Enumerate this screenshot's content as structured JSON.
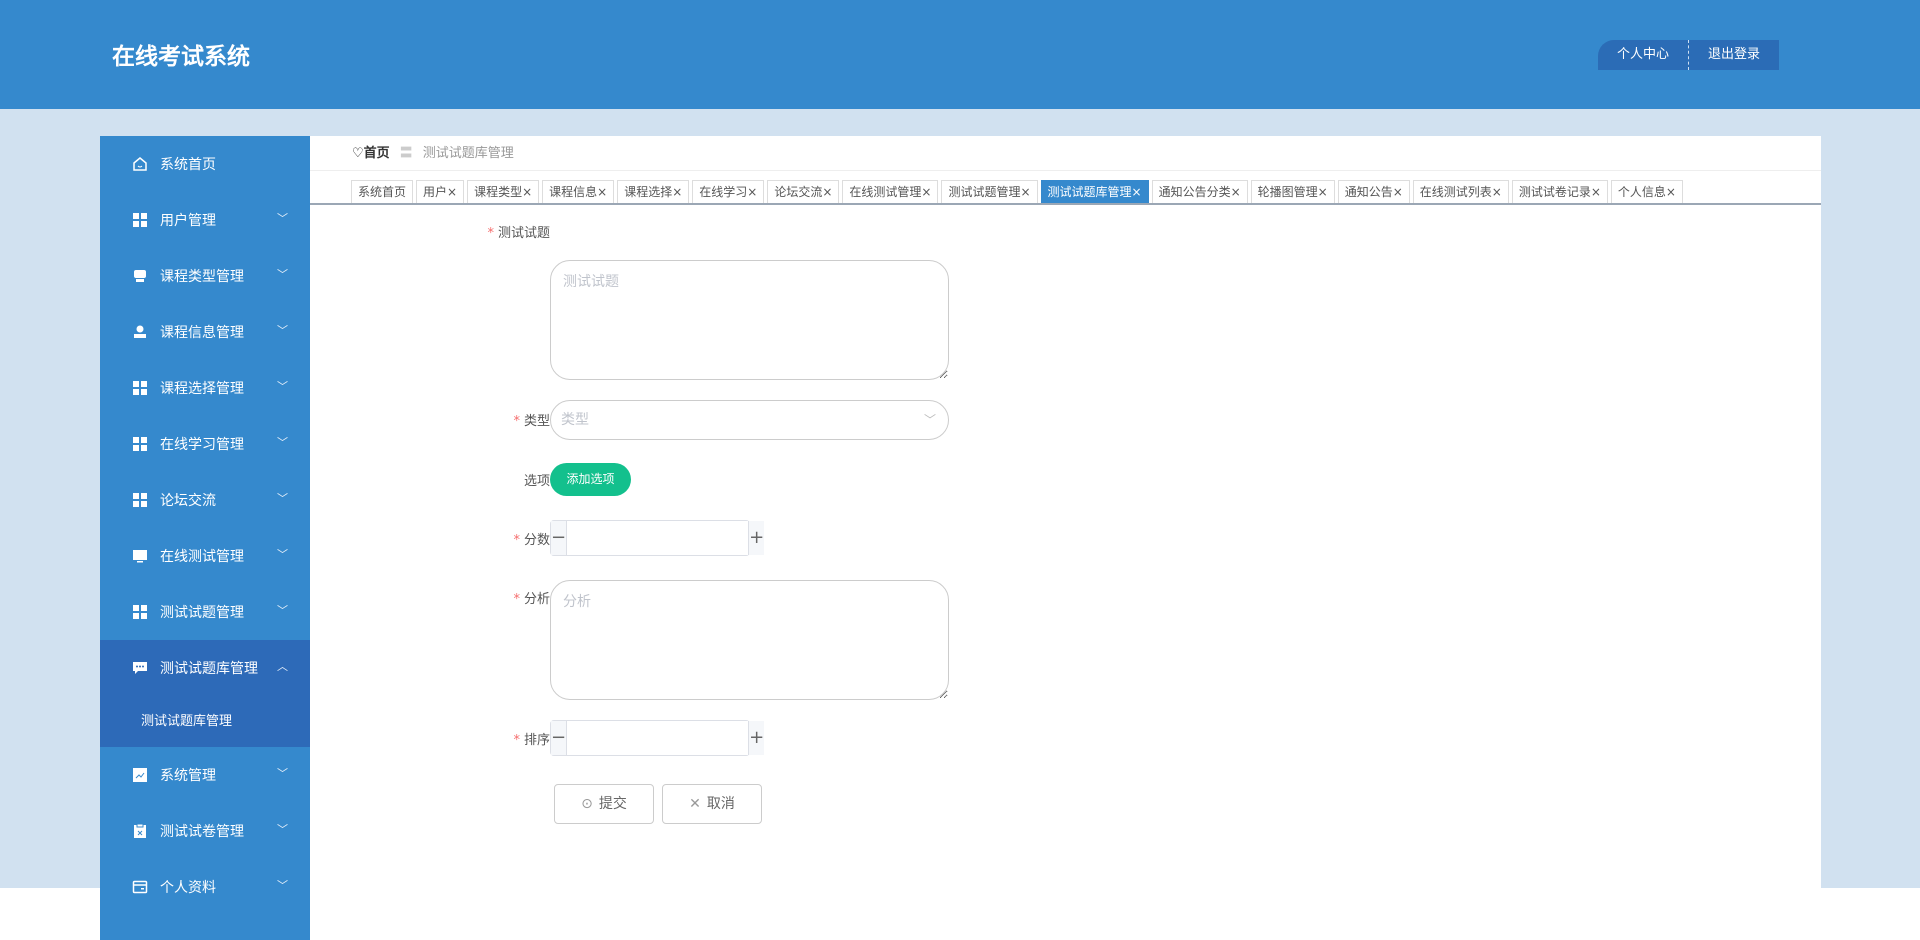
{
  "header": {
    "title": "在线考试系统",
    "personal_center": "个人中心",
    "logout": "退出登录"
  },
  "sidebar": {
    "items": [
      {
        "label": "系统首页",
        "icon": "home-icon",
        "chevron": ""
      },
      {
        "label": "用户管理",
        "icon": "grid-icon",
        "chevron": "﹀"
      },
      {
        "label": "课程类型管理",
        "icon": "tray-icon",
        "chevron": "﹀"
      },
      {
        "label": "课程信息管理",
        "icon": "stamp-icon",
        "chevron": "﹀"
      },
      {
        "label": "课程选择管理",
        "icon": "grid-icon",
        "chevron": "﹀"
      },
      {
        "label": "在线学习管理",
        "icon": "grid-icon",
        "chevron": "﹀"
      },
      {
        "label": "论坛交流",
        "icon": "grid-icon",
        "chevron": "﹀"
      },
      {
        "label": "在线测试管理",
        "icon": "monitor-icon",
        "chevron": "﹀"
      },
      {
        "label": "测试试题管理",
        "icon": "grid-icon",
        "chevron": "﹀"
      },
      {
        "label": "测试试题库管理",
        "icon": "chat-icon",
        "chevron": "︿"
      },
      {
        "label": "系统管理",
        "icon": "chart-icon",
        "chevron": "﹀"
      },
      {
        "label": "测试试卷管理",
        "icon": "clipboard-icon",
        "chevron": "﹀"
      },
      {
        "label": "个人资料",
        "icon": "card-icon",
        "chevron": "﹀"
      }
    ],
    "sub_item": "测试试题库管理"
  },
  "breadcrumb": {
    "home": "首页",
    "separator": "〓",
    "current": "测试试题库管理"
  },
  "tabs": [
    {
      "label": "系统首页"
    },
    {
      "label": "用户×"
    },
    {
      "label": "课程类型×"
    },
    {
      "label": "课程信息×"
    },
    {
      "label": "课程选择×"
    },
    {
      "label": "在线学习×"
    },
    {
      "label": "论坛交流×"
    },
    {
      "label": "在线测试管理×"
    },
    {
      "label": "测试试题管理×"
    },
    {
      "label": "测试试题库管理×",
      "active": true
    },
    {
      "label": "通知公告分类×"
    },
    {
      "label": "轮播图管理×"
    },
    {
      "label": "通知公告×"
    },
    {
      "label": "在线测试列表×"
    },
    {
      "label": "测试试卷记录×"
    },
    {
      "label": "个人信息×"
    }
  ],
  "form": {
    "question": {
      "label": "测试试题",
      "placeholder": "测试试题",
      "required": "*"
    },
    "type": {
      "label": "类型",
      "placeholder": "类型",
      "required": "*"
    },
    "options": {
      "label": "选项",
      "button": "添加选项"
    },
    "score": {
      "label": "分数",
      "required": "*",
      "value": ""
    },
    "analysis": {
      "label": "分析",
      "placeholder": "分析",
      "required": "*"
    },
    "sort": {
      "label": "排序",
      "required": "*",
      "value": ""
    },
    "submit": "提交",
    "cancel": "取消",
    "minus": "−",
    "plus": "+",
    "submit_icon": "⊙",
    "cancel_icon": "✕"
  },
  "colors": {
    "primary": "#3589cd",
    "active": "#2d6ab8",
    "success": "#13c08d",
    "required": "#f56c6c"
  }
}
